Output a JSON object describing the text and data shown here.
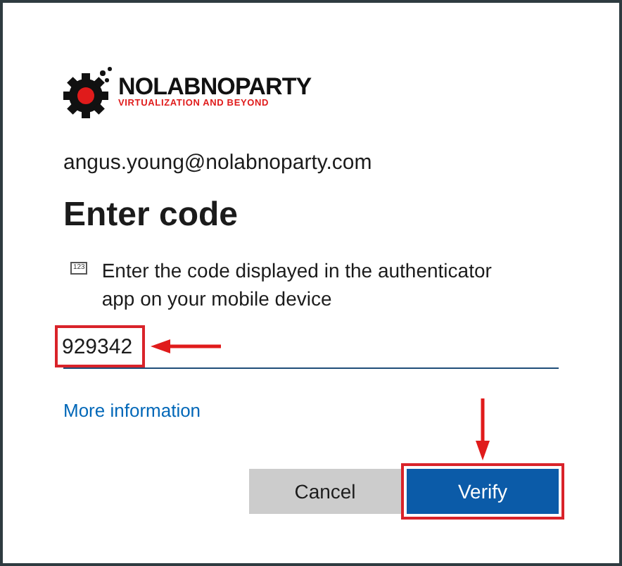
{
  "logo": {
    "name": "NOLABNOPARTY",
    "tagline": "VIRTUALIZATION AND BEYOND"
  },
  "account": "angus.young@nolabnoparty.com",
  "heading": "Enter code",
  "instruction": {
    "icon_text": "123",
    "text": "Enter the code displayed in the authenticator app on your mobile device"
  },
  "code_field": {
    "value": "929342"
  },
  "link": "More information",
  "buttons": [
    {
      "label": "Cancel",
      "kind": "secondary"
    },
    {
      "label": "Verify",
      "kind": "primary"
    }
  ]
}
